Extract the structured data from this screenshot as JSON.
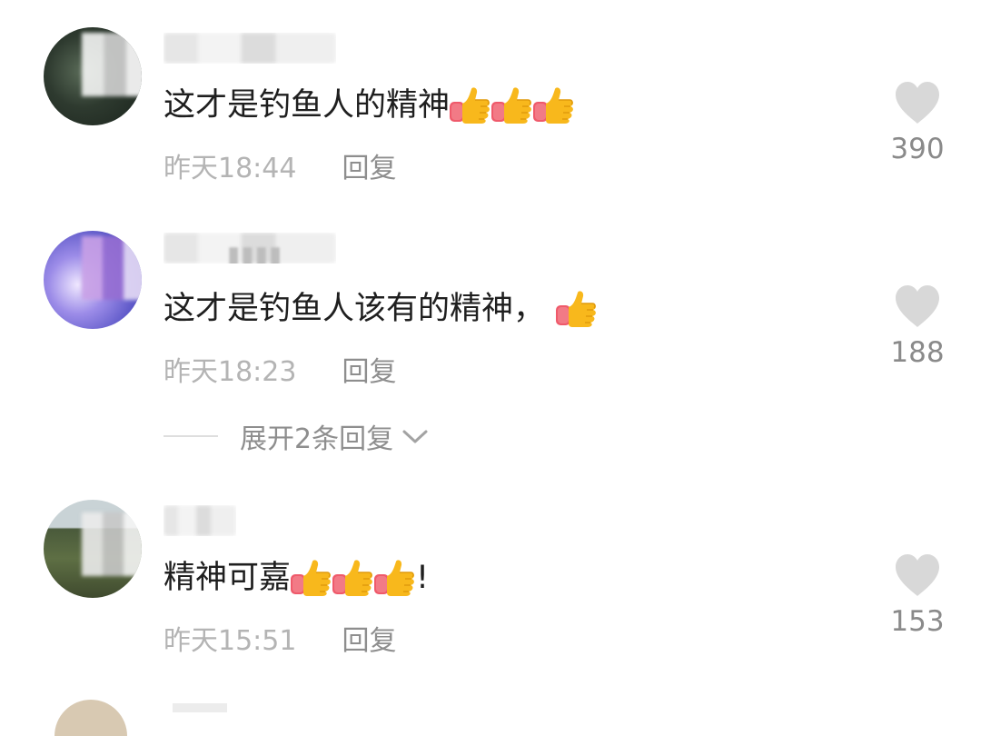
{
  "comments": [
    {
      "content": "这才是钓鱼人的精神",
      "emoji_count": 3,
      "time": "昨天18:44",
      "reply_label": "回复",
      "likes": "390"
    },
    {
      "content": "这才是钓鱼人该有的精神，",
      "emoji_count": 1,
      "time": "昨天18:23",
      "reply_label": "回复",
      "likes": "188"
    },
    {
      "content": "精神可嘉",
      "suffix": "!",
      "emoji_count": 3,
      "time": "昨天15:51",
      "reply_label": "回复",
      "likes": "153"
    }
  ],
  "expand_replies_label": "展开2条回复",
  "colors": {
    "heart": "#d8d8d8",
    "meta_text": "#b4b4b4",
    "count_text": "#8a8a8a",
    "thumb_yellow": "#f7b21b",
    "thumb_cuff": "#ef5a6b"
  }
}
